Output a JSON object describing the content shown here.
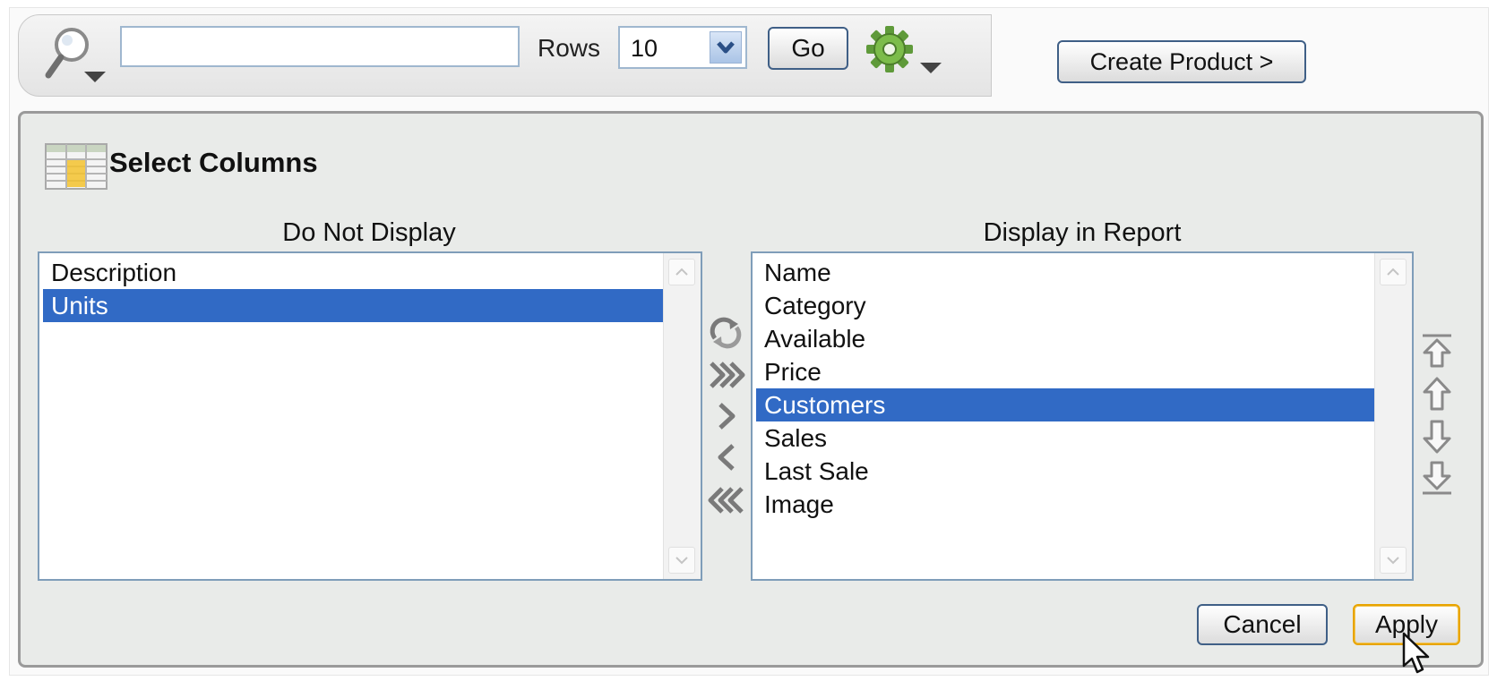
{
  "toolbar": {
    "search_value": "",
    "rows_label": "Rows",
    "rows_value": "10",
    "go_label": "Go",
    "create_label": "Create Product >"
  },
  "panel": {
    "title": "Select Columns",
    "left_heading": "Do Not Display",
    "right_heading": "Display in Report",
    "left_items": [
      "Description",
      "Units"
    ],
    "left_selected": "Units",
    "right_items": [
      "Name",
      "Category",
      "Available",
      "Price",
      "Customers",
      "Sales",
      "Last Sale",
      "Image"
    ],
    "right_selected": "Customers",
    "cancel_label": "Cancel",
    "apply_label": "Apply"
  },
  "icons": {
    "search": "search-icon",
    "gear": "gear-icon",
    "columns": "columns-table-icon",
    "reset": "reset-icon",
    "move_all_right": "move-all-right-icon",
    "move_right": "move-right-icon",
    "move_left": "move-left-icon",
    "move_all_left": "move-all-left-icon",
    "move_top": "move-top-icon",
    "move_up": "move-up-icon",
    "move_down": "move-down-icon",
    "move_bottom": "move-bottom-icon"
  },
  "colors": {
    "selection": "#316ac5",
    "button_border": "#3f5f86",
    "apply_border": "#e8a400"
  }
}
